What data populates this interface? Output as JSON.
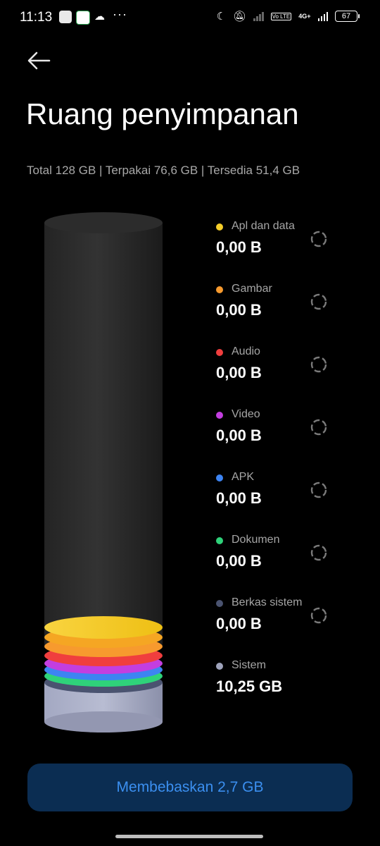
{
  "status_bar": {
    "time": "11:13",
    "battery": "67",
    "network": "4G+",
    "volte": "Vo LTE"
  },
  "header": {
    "title": "Ruang penyimpanan",
    "summary": "Total 128 GB | Terpakai 76,6 GB | Tersedia 51,4 GB"
  },
  "categories": [
    {
      "label": "Apl dan data",
      "value": "0,00 B",
      "color": "#f5cd29",
      "loading": true
    },
    {
      "label": "Gambar",
      "value": "0,00 B",
      "color": "#f79a2e",
      "loading": true
    },
    {
      "label": "Audio",
      "value": "0,00 B",
      "color": "#f03e3e",
      "loading": true
    },
    {
      "label": "Video",
      "value": "0,00 B",
      "color": "#c33ee0",
      "loading": true
    },
    {
      "label": "APK",
      "value": "0,00 B",
      "color": "#3d84f2",
      "loading": true
    },
    {
      "label": "Dokumen",
      "value": "0,00 B",
      "color": "#2fd27a",
      "loading": true
    },
    {
      "label": "Berkas sistem",
      "value": "0,00 B",
      "color": "#4a5370",
      "loading": true
    },
    {
      "label": "Sistem",
      "value": "10,25 GB",
      "color": "#9ea3bb",
      "loading": false
    }
  ],
  "actions": {
    "free_up": "Membebaskan 2,7 GB"
  }
}
